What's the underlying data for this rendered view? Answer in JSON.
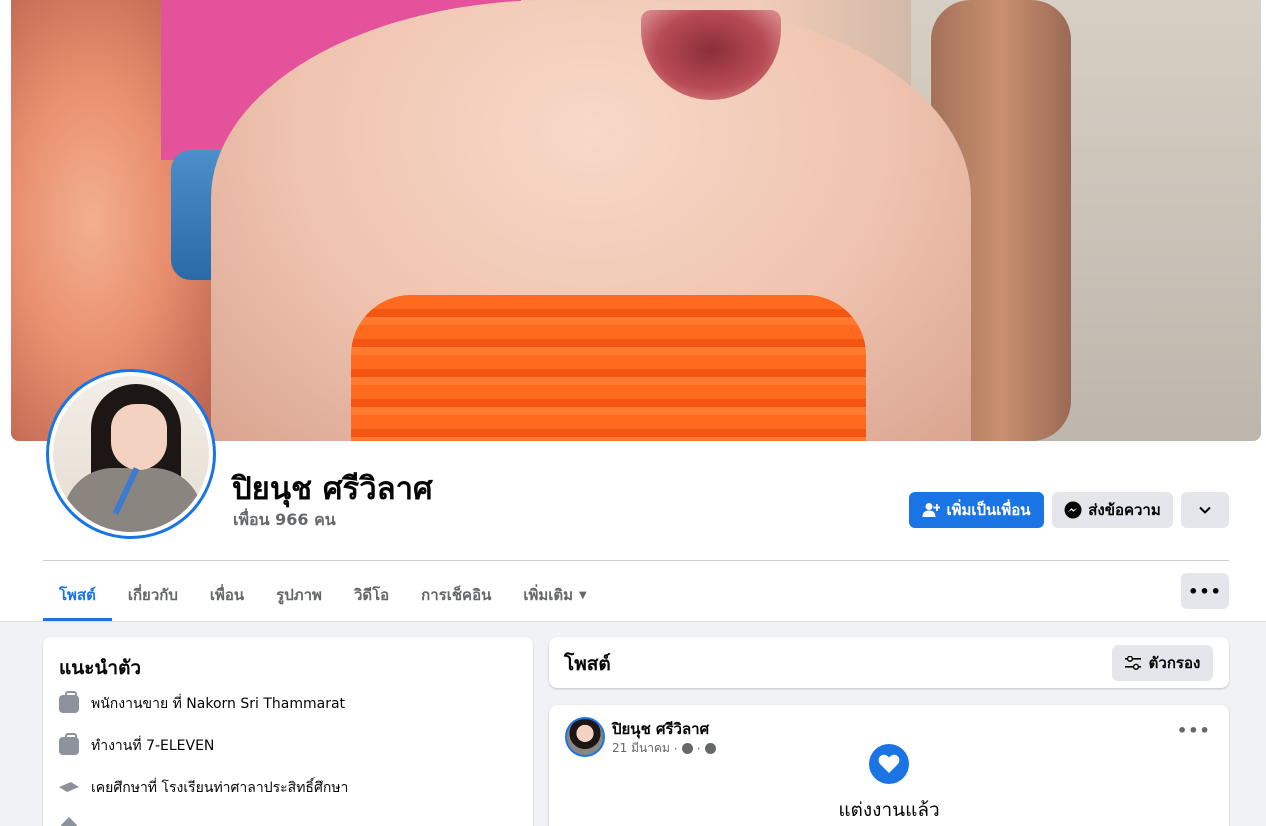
{
  "profile": {
    "name": "ปิยนุช ศรีวิลาศ",
    "friends": "เพื่อน 966 คน"
  },
  "actions": {
    "add_friend": "เพิ่มเป็นเพื่อน",
    "message": "ส่งข้อความ"
  },
  "tabs": [
    {
      "label": "โพสต์"
    },
    {
      "label": "เกี่ยวกับ"
    },
    {
      "label": "เพื่อน"
    },
    {
      "label": "รูปภาพ"
    },
    {
      "label": "วิดีโอ"
    },
    {
      "label": "การเช็คอิน"
    },
    {
      "label": "เพิ่มเติม"
    }
  ],
  "intro": {
    "title": "แนะนำตัว",
    "items": [
      {
        "icon": "briefcase-icon",
        "text": "พนักงานขาย ที่ Nakorn Sri Thammarat"
      },
      {
        "icon": "briefcase-icon",
        "text": "ทำงานที่ 7-ELEVEN"
      },
      {
        "icon": "graduation-cap-icon",
        "text": "เคยศึกษาที่ โรงเรียนท่าศาลาประสิทธิ์ศึกษา"
      }
    ]
  },
  "posts": {
    "title": "โพสต์",
    "filter_label": "ตัวกรอง"
  },
  "post": {
    "author": "ปิยนุช ศรีวิลาศ",
    "date": "21 มีนาคม",
    "sep": "·",
    "life_event": "แต่งงานแล้ว"
  },
  "colors": {
    "accent": "#1b74e4",
    "button_gray": "#e4e6eb",
    "secondary_text": "#65676b",
    "page_bg": "#f0f2f5"
  }
}
